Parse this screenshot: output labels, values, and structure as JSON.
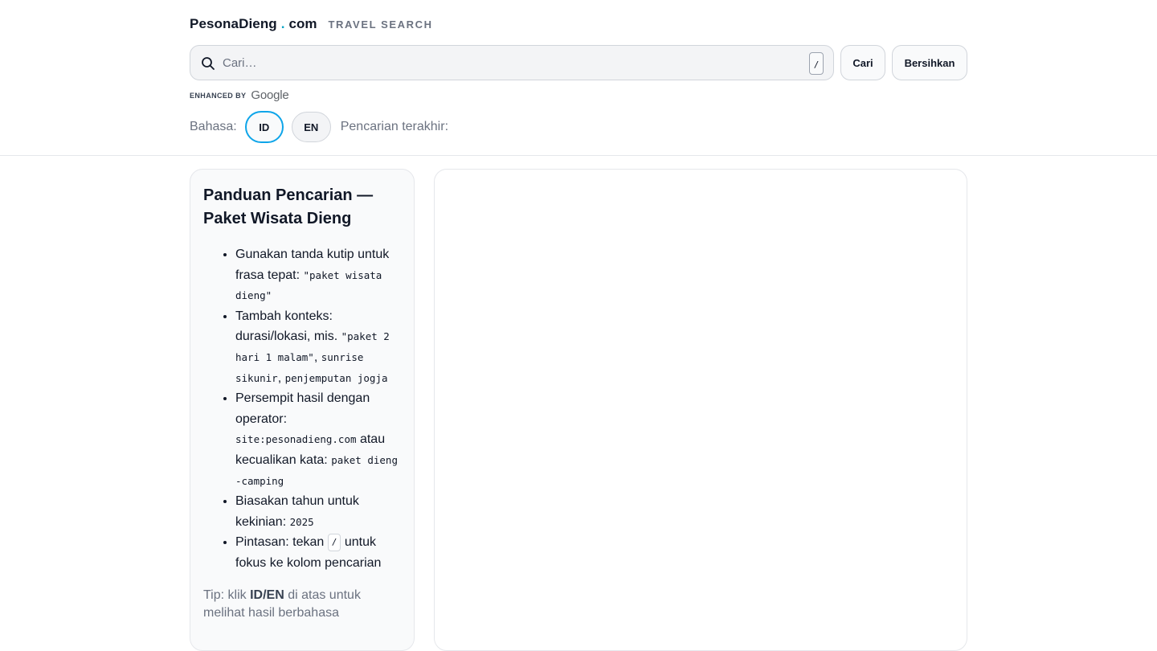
{
  "header": {
    "brand_name": "PesonaDieng",
    "brand_dot": ".",
    "brand_tld": "com",
    "brand_subtitle": "TRAVEL SEARCH"
  },
  "search": {
    "placeholder": "Cari…",
    "value": "",
    "shortcut_key": "/",
    "search_button": "Cari",
    "clear_button": "Bersihkan",
    "enhanced_label": "ENHANCED BY",
    "enhanced_brand": "Google"
  },
  "language": {
    "label": "Bahasa:",
    "options": [
      "ID",
      "EN"
    ],
    "selected": "ID",
    "recent_label": "Pencarian terakhir:"
  },
  "guide": {
    "title": "Panduan Pencarian — Paket Wisata Dieng",
    "items": [
      {
        "text": "Gunakan tanda kutip untuk frasa tepat: ",
        "code": "\"paket wisata dieng\""
      },
      {
        "text": "Tambah konteks: durasi/lokasi, mis. ",
        "code1": "\"paket 2 hari 1 malam\"",
        "sep1": ", ",
        "code2": "sunrise sikunir",
        "sep2": ", ",
        "code3": "penjemputan jogja"
      },
      {
        "text": "Persempit hasil dengan operator: ",
        "code1": "site:pesonadieng.com",
        "mid": " atau kecualikan kata: ",
        "code2": "paket dieng -camping"
      },
      {
        "text": "Biasakan tahun untuk kekinian: ",
        "code": "2025"
      },
      {
        "text": "Pintasan: tekan ",
        "kbd": "/",
        "after": " untuk fokus ke kolom pencarian"
      }
    ],
    "tip_prefix": "Tip: klik ",
    "tip_id": "ID",
    "tip_slash": "/",
    "tip_en": "EN",
    "tip_suffix": " di atas untuk melihat hasil berbahasa"
  },
  "colors": {
    "accent": "#0ea5e9",
    "brand_dot": "#0ea5c6",
    "muted_text": "#6b7280",
    "border": "#e5e7eb"
  },
  "icons": {
    "search": "search-icon"
  }
}
